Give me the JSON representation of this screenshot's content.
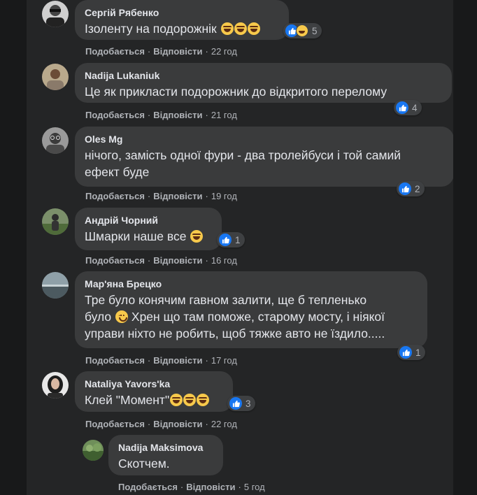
{
  "comments": [
    {
      "author": "Сергій Рябенко",
      "text": "Ізоленту на подорожнік",
      "emoji": "rolling-laughing x3",
      "reactions": "like, haha",
      "count": "5",
      "like": "Подобається",
      "reply": "Відповісти",
      "time": "22 год"
    },
    {
      "author": "Nadija Lukaniuk",
      "text": "Це як прикласти подорожник до відкритого перелому",
      "reactions": "like",
      "count": "4",
      "like": "Подобається",
      "reply": "Відповісти",
      "time": "21 год"
    },
    {
      "author": "Oles Mg",
      "text_line1": "нічого, замість одної фури - два тролейбуси і той самий",
      "text_line2": "ефект буде",
      "reactions": "like",
      "count": "2",
      "like": "Подобається",
      "reply": "Відповісти",
      "time": "19 год"
    },
    {
      "author": "Андрій Чорний",
      "text": "Шмарки наше все",
      "emoji": "grinning",
      "reactions": "like",
      "count": "1",
      "like": "Подобається",
      "reply": "Відповісти",
      "time": "16 год"
    },
    {
      "author": "Мар'яна Брецко",
      "text_line1": "Тре було конячим гавном залити, ще б тепленько",
      "text_line2a": "було",
      "text_line2b": "Хрен що там поможе, старому мосту, і ніякої",
      "text_line3": "управи ніхто не робить, щоб тяжке авто не їздило.....",
      "emoji": "smiling",
      "reactions": "like",
      "count": "1",
      "like": "Подобається",
      "reply": "Відповісти",
      "time": "17 год"
    },
    {
      "author": "Nataliya Yavors'ka",
      "text": "Клей \"Момент\"",
      "emoji": "grinning x3",
      "reactions": "like",
      "count": "3",
      "like": "Подобається",
      "reply": "Відповісти",
      "time": "22 год"
    },
    {
      "author": "Nadija Maksimova",
      "text": "Скотчем.",
      "like": "Подобається",
      "reply": "Відповісти",
      "time": "5 год"
    }
  ],
  "separator": "·",
  "colors": {
    "background": "#18191a",
    "panel": "#242526",
    "bubble": "#3a3b3c",
    "text": "#e4e6eb",
    "secondary": "#b0b3b8",
    "like_blue": "#1877f2"
  }
}
